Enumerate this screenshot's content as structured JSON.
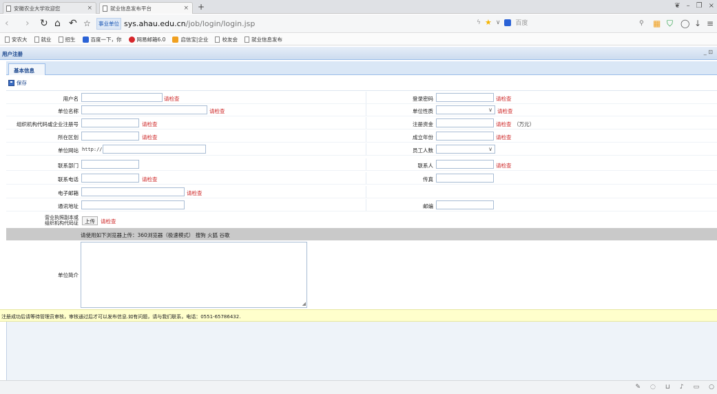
{
  "browser": {
    "tabs": [
      {
        "title": "安徽农业大学欢迎您",
        "active": false
      },
      {
        "title": "就业信息发布平台",
        "active": true
      }
    ],
    "new_tab": "+",
    "address": {
      "badge": "事业单位",
      "host": "sys.ahau.edu.cn",
      "path": "/job/login/login.jsp"
    },
    "search_placeholder": "百度",
    "bookmarks": [
      "安农大",
      "就业",
      "招生",
      "百度一下，你",
      "网易邮箱6.0",
      "启信宝|企业",
      "校友会",
      "就业信息发布"
    ],
    "colors": {
      "bookmark_baidu": "#2a62d6",
      "bookmark_netease": "#d6262b",
      "bookmark_qixin": "#f0a020"
    }
  },
  "panel": {
    "title": "用户注册",
    "tools": "_ ⊡"
  },
  "inner_tab": "基本信息",
  "toolbar": {
    "save_label": "保存"
  },
  "form": {
    "check": "请检查",
    "username": "用户名",
    "password": "登录密码",
    "company_name": "单位名称",
    "company_type": "单位性质",
    "org_code": "组织机构代码或企业注册号",
    "capital": "注册资金",
    "capital_unit": "（万元）",
    "district": "所在区划",
    "founded_year": "成立年份",
    "website": "单位网站",
    "website_prefix": "http://",
    "employees": "员工人数",
    "department": "联系部门",
    "contact": "联系人",
    "phone": "联系电话",
    "fax": "传真",
    "email": "电子邮箱",
    "address": "通讯地址",
    "postcode": "邮编",
    "license_label_1": "营业执照副本或",
    "license_label_2": "组织机构代码证",
    "upload_label": "上传",
    "browser_notice": "请使用如下浏览器上传：360浏览器（极速模式） 搜狗 火狐 谷歌",
    "intro": "单位简介"
  },
  "footer_notice": "注册成功后请等待管理员审核，审核通过后才可以发布信息.如有问题，请与我们联系，电话：0551-65786432.",
  "accent": "#15428b",
  "warn_color": "#cc2222"
}
